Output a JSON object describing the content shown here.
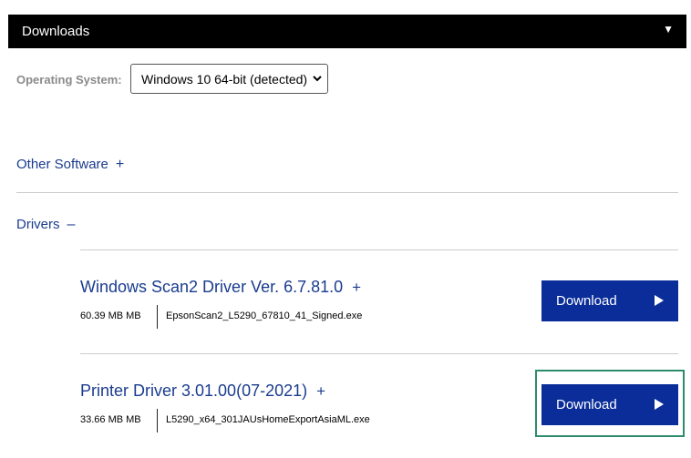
{
  "header": {
    "title": "Downloads",
    "caret_icon": "triangle-down-icon",
    "caret_glyph": "▼"
  },
  "os": {
    "label": "Operating System:",
    "selected": "Windows 10 64-bit (detected)",
    "chevron_icon": "chevron-down-icon"
  },
  "sections": {
    "other_software": {
      "label": "Other Software",
      "toggle": "+"
    },
    "drivers": {
      "label": "Drivers",
      "toggle": "–"
    }
  },
  "drivers": [
    {
      "title": "Windows Scan2 Driver Ver. 6.7.81.0",
      "toggle": "+",
      "size": "60.39 MB MB",
      "file": "EpsonScan2_L5290_67810_41_Signed.exe",
      "button_label": "Download"
    },
    {
      "title": "Printer Driver 3.01.00(07-2021)",
      "toggle": "+",
      "size": "33.66 MB MB",
      "file": "L5290_x64_301JAUsHomeExportAsiaML.exe",
      "button_label": "Download",
      "highlighted": true
    }
  ],
  "colors": {
    "header_bg": "#000000",
    "link": "#1a3c8f",
    "button_bg": "#0a2d99",
    "highlight": "#2e8b6e"
  }
}
